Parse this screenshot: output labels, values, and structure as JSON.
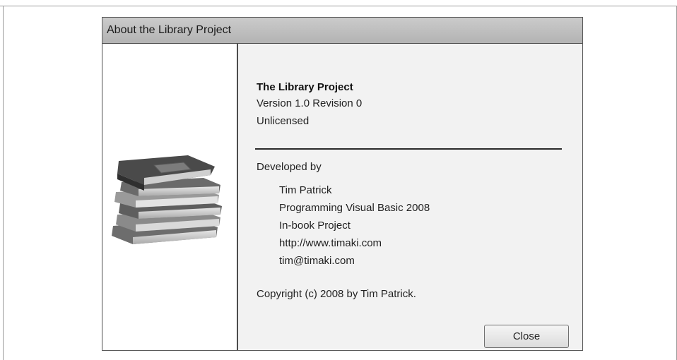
{
  "dialog": {
    "title": "About the Library Project"
  },
  "left_pane": {
    "image_icon": "stack-of-books-icon"
  },
  "about": {
    "app_name": "The Library Project",
    "version": "Version 1.0 Revision 0",
    "license": "Unlicensed",
    "developed_by_label": "Developed by",
    "developer_lines": [
      "Tim Patrick",
      "Programming Visual Basic 2008",
      "In-book Project",
      "http://www.timaki.com",
      "tim@timaki.com"
    ],
    "copyright": "Copyright (c) 2008 by Tim Patrick."
  },
  "buttons": {
    "close_label": "Close"
  }
}
